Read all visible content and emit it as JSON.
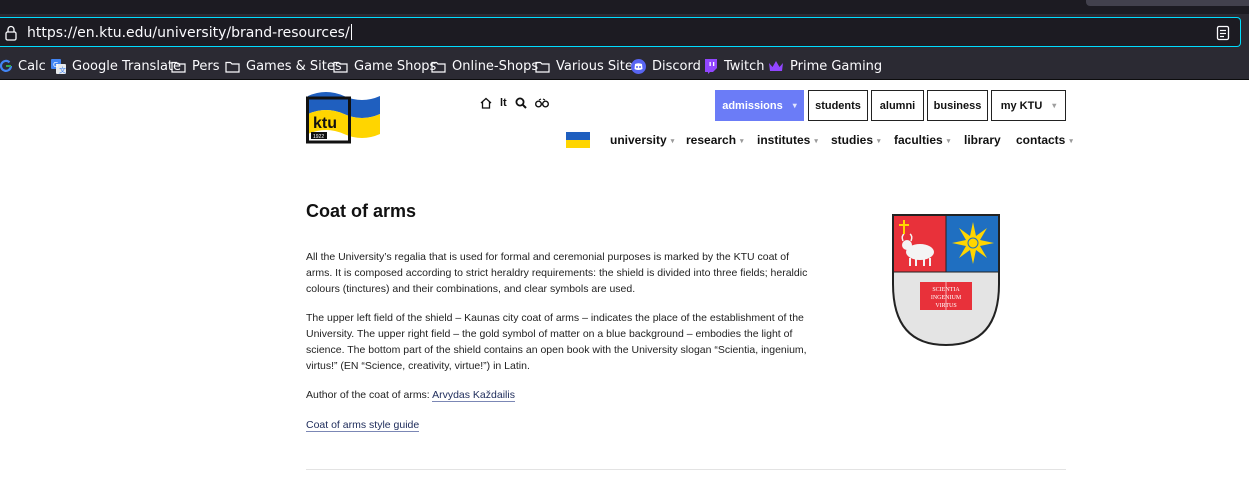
{
  "browser": {
    "url": "https://en.ktu.edu/university/brand-resources/",
    "bookmarks": [
      {
        "label": "Calc",
        "icon": "google-icon"
      },
      {
        "label": "Google Translate",
        "icon": "translate-icon"
      },
      {
        "label": "Pers",
        "icon": "folder-icon"
      },
      {
        "label": "Games & Sites",
        "icon": "folder-icon"
      },
      {
        "label": "Game Shops",
        "icon": "folder-icon"
      },
      {
        "label": "Online-Shops",
        "icon": "folder-icon"
      },
      {
        "label": "Various Sites",
        "icon": "folder-icon"
      },
      {
        "label": "Discord",
        "icon": "discord-icon"
      },
      {
        "label": "Twitch",
        "icon": "twitch-icon"
      },
      {
        "label": "Prime Gaming",
        "icon": "crown-icon"
      }
    ]
  },
  "header": {
    "logo_text": "ktu",
    "logo_year": "1922",
    "language": "lt",
    "buttons": {
      "admissions": "admissions",
      "students": "students",
      "alumni": "alumni",
      "business": "business",
      "my_ktu": "my KTU"
    },
    "nav": {
      "university": "university",
      "research": "research",
      "institutes": "institutes",
      "studies": "studies",
      "faculties": "faculties",
      "library": "library",
      "contacts": "contacts"
    }
  },
  "main": {
    "title": "Coat of arms",
    "para1": "All the University’s regalia that is used for formal and ceremonial purposes is marked by the KTU coat of arms. It is composed according to strict heraldry requirements: the shield is divided into three fields; heraldic colours (tinctures) and their combinations, and clear symbols are used.",
    "para2": "The upper left field of the shield – Kaunas city coat of arms – indicates the place of the establishment of the University. The upper right field – the gold symbol of matter on a blue background – embodies the light of science. The bottom part of the shield contains an open book with the University slogan “Scientia, ingenium, virtus!” (EN “Science, creativity, virtue!”) in Latin.",
    "author_label": "Author of the coat of arms: ",
    "author_name": "Arvydas Každailis",
    "style_guide": "Coat of arms style guide",
    "book_line1": "SCIENTIA",
    "book_line2": "INGENIUM",
    "book_line3": "VIRTUS"
  },
  "colors": {
    "accent": "#6b7cf7",
    "ukraine_blue": "#1f5fbf",
    "ukraine_yellow": "#ffd500",
    "shield_red": "#e8313a",
    "shield_blue": "#1f6fc1"
  }
}
